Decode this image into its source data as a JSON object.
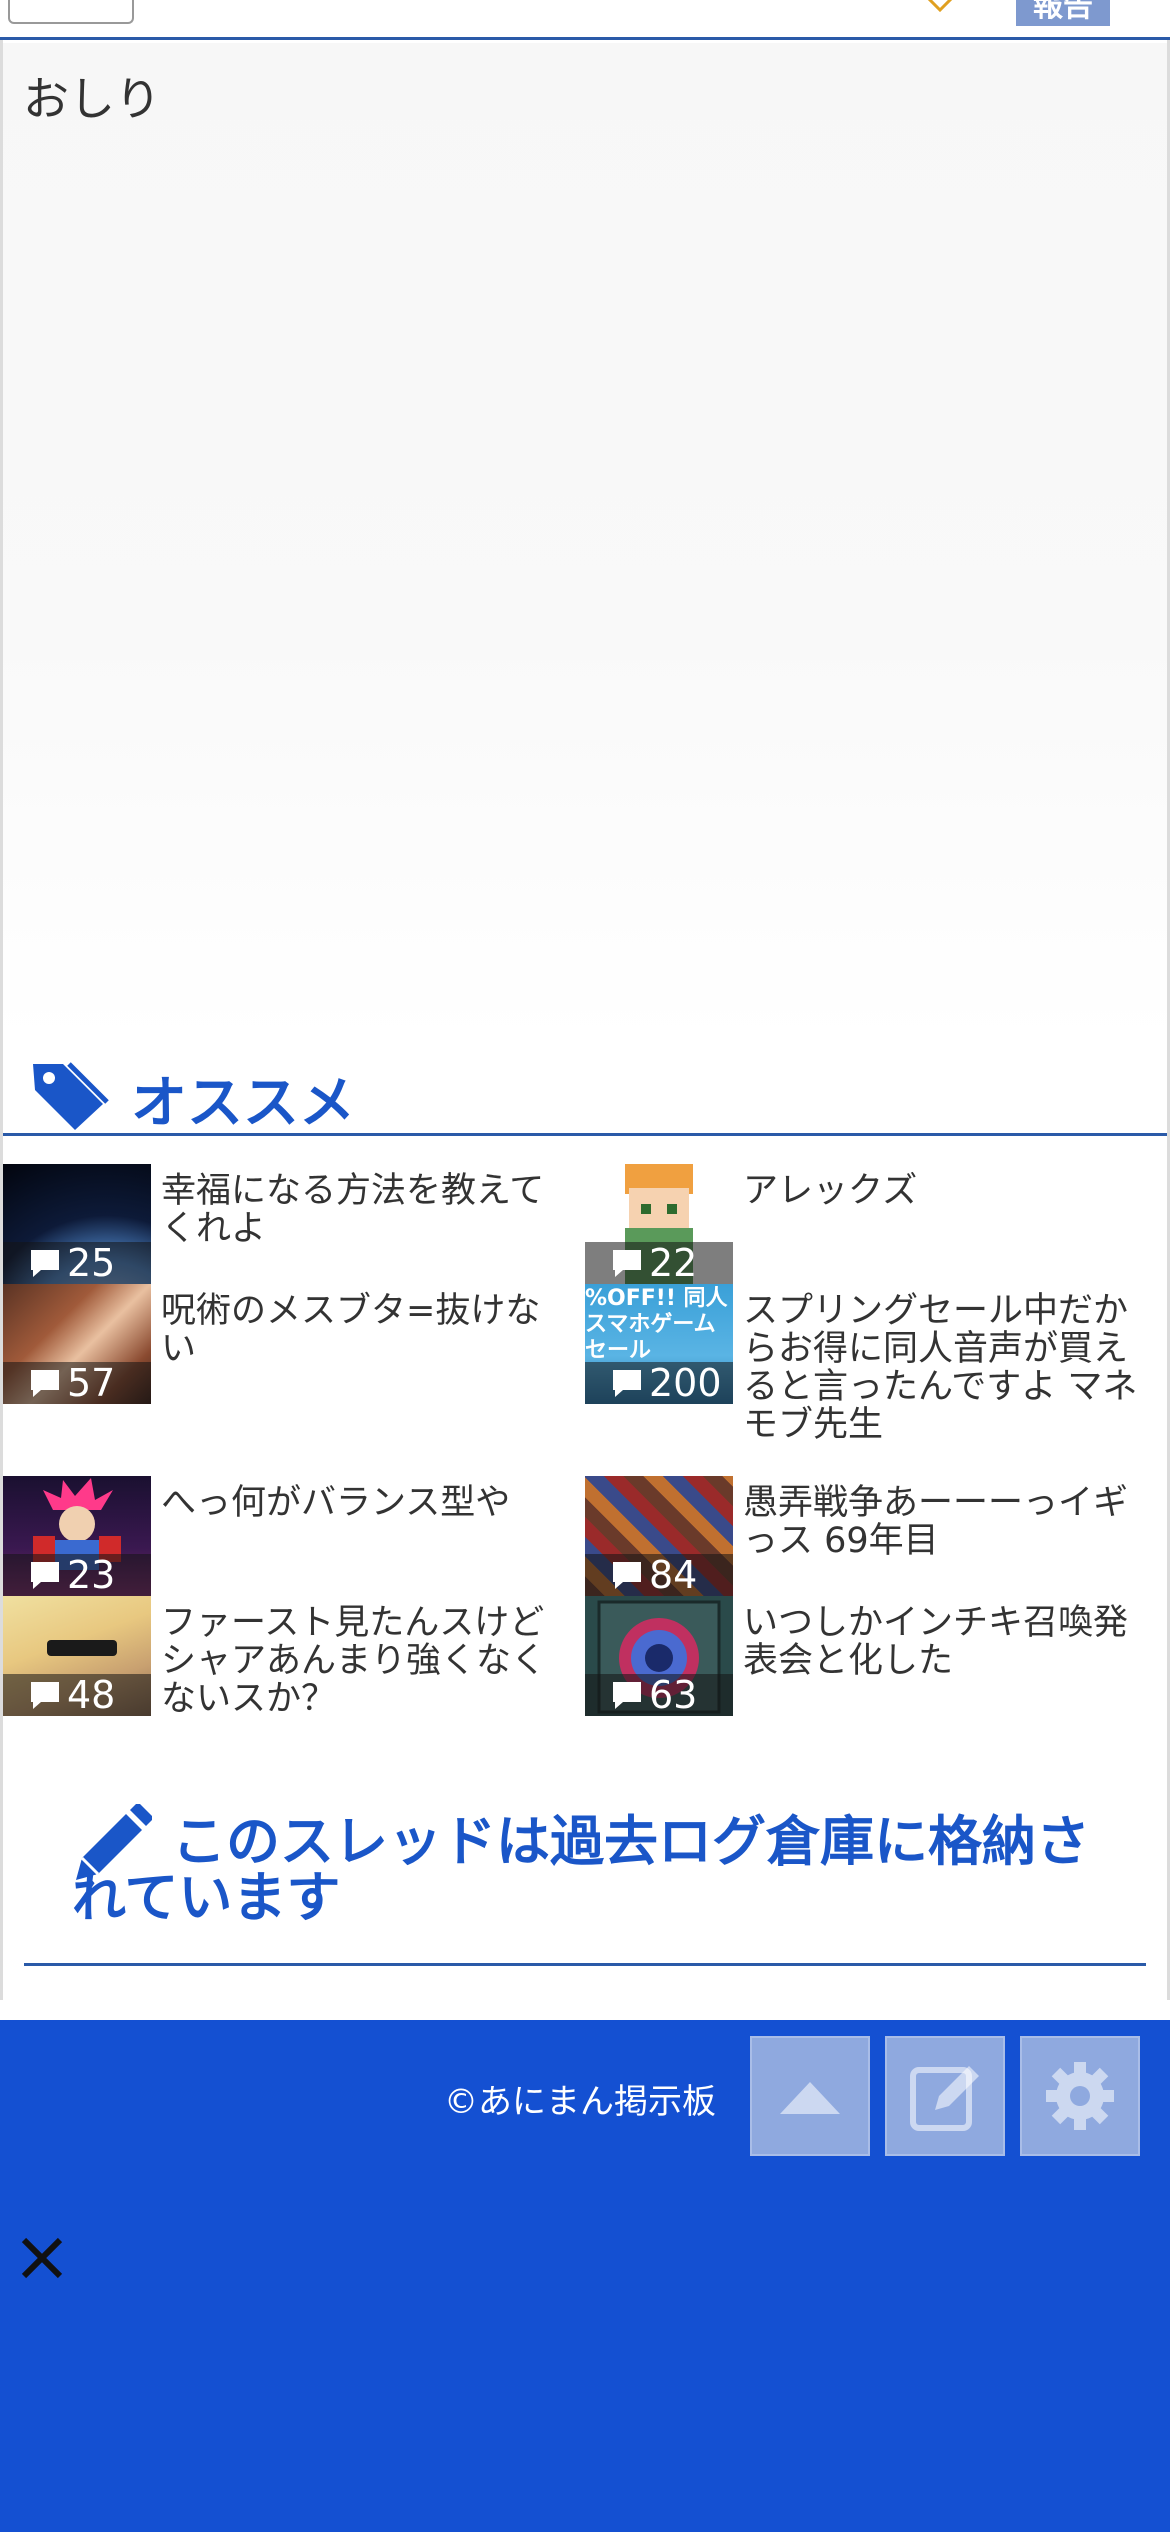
{
  "header": {
    "report_label": "報告"
  },
  "post": {
    "text": "おしり"
  },
  "recommend": {
    "title": "オススメ",
    "items": [
      {
        "title": "幸福になる方法を教えてくれよ",
        "count": "25"
      },
      {
        "title": "アレックズ",
        "count": "22"
      },
      {
        "title": "呪術のメスブタ=抜けない",
        "count": "57"
      },
      {
        "title": "スプリングセール中だからお得に同人音声が買えると言ったんですよ マネモブ先生",
        "count": "200"
      },
      {
        "title": "へっ何がバランス型や",
        "count": "23"
      },
      {
        "title": "愚弄戦争あーーーっイギっス 69年目",
        "count": "84"
      },
      {
        "title": "ファースト見たんスけどシャアあんまり強くなくないスか？",
        "count": "48"
      },
      {
        "title": "いつしかインチキ召喚発表会と化した",
        "count": "63"
      }
    ],
    "thumb_texts": {
      "sale_line1": "%OFF!! 同人",
      "sale_line2": "スマホゲーム",
      "sale_line3": "セール"
    }
  },
  "archive": {
    "message": "このスレッドは過去ログ倉庫に格納されています"
  },
  "footer": {
    "copyright": "©あにまん掲示板",
    "buttons": [
      "scroll-top-icon",
      "edit-icon",
      "gear-icon"
    ]
  },
  "colors": {
    "accent": "#1a56c8",
    "footer_bg": "#1450d2",
    "rule": "#2a5aa8"
  }
}
